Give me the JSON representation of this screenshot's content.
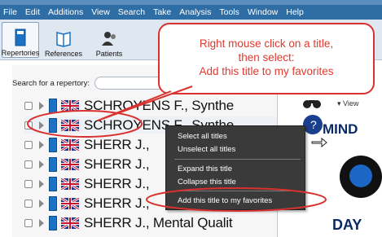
{
  "menu": [
    "File",
    "Edit",
    "Additions",
    "View",
    "Search",
    "Take",
    "Analysis",
    "Tools",
    "Window",
    "Help"
  ],
  "toolbar": {
    "repertories": "Repertories",
    "references": "References",
    "patients": "Patients"
  },
  "search": {
    "label": "Search for a repertory:"
  },
  "rows": [
    "SCHROYENS F., Synthe",
    "SCHROYENS F., Synthe",
    "SHERR J., ",
    "SHERR J., ",
    "SHERR J., ",
    "SHERR J., ",
    "SHERR J., Mental Qualit"
  ],
  "context_menu": {
    "select_all": "Select all titles",
    "unselect_all": "Unselect all titles",
    "expand": "Expand this title",
    "collapse": "Collapse this title",
    "add_fav": "Add this title to my favorites"
  },
  "callout": {
    "line1": "Right mouse click on a title,",
    "line2": "then select:",
    "line3": "Add this title to my favorites"
  },
  "right_panel": {
    "view": "▾ View",
    "mind": "MIND",
    "day": "DAY"
  },
  "colors": {
    "menubar": "#2f6ea5",
    "callout_border": "#d9312f",
    "callout_text": "#e03a2f",
    "context_bg": "#3a3a3a",
    "book_blue": "#1b72c5"
  }
}
